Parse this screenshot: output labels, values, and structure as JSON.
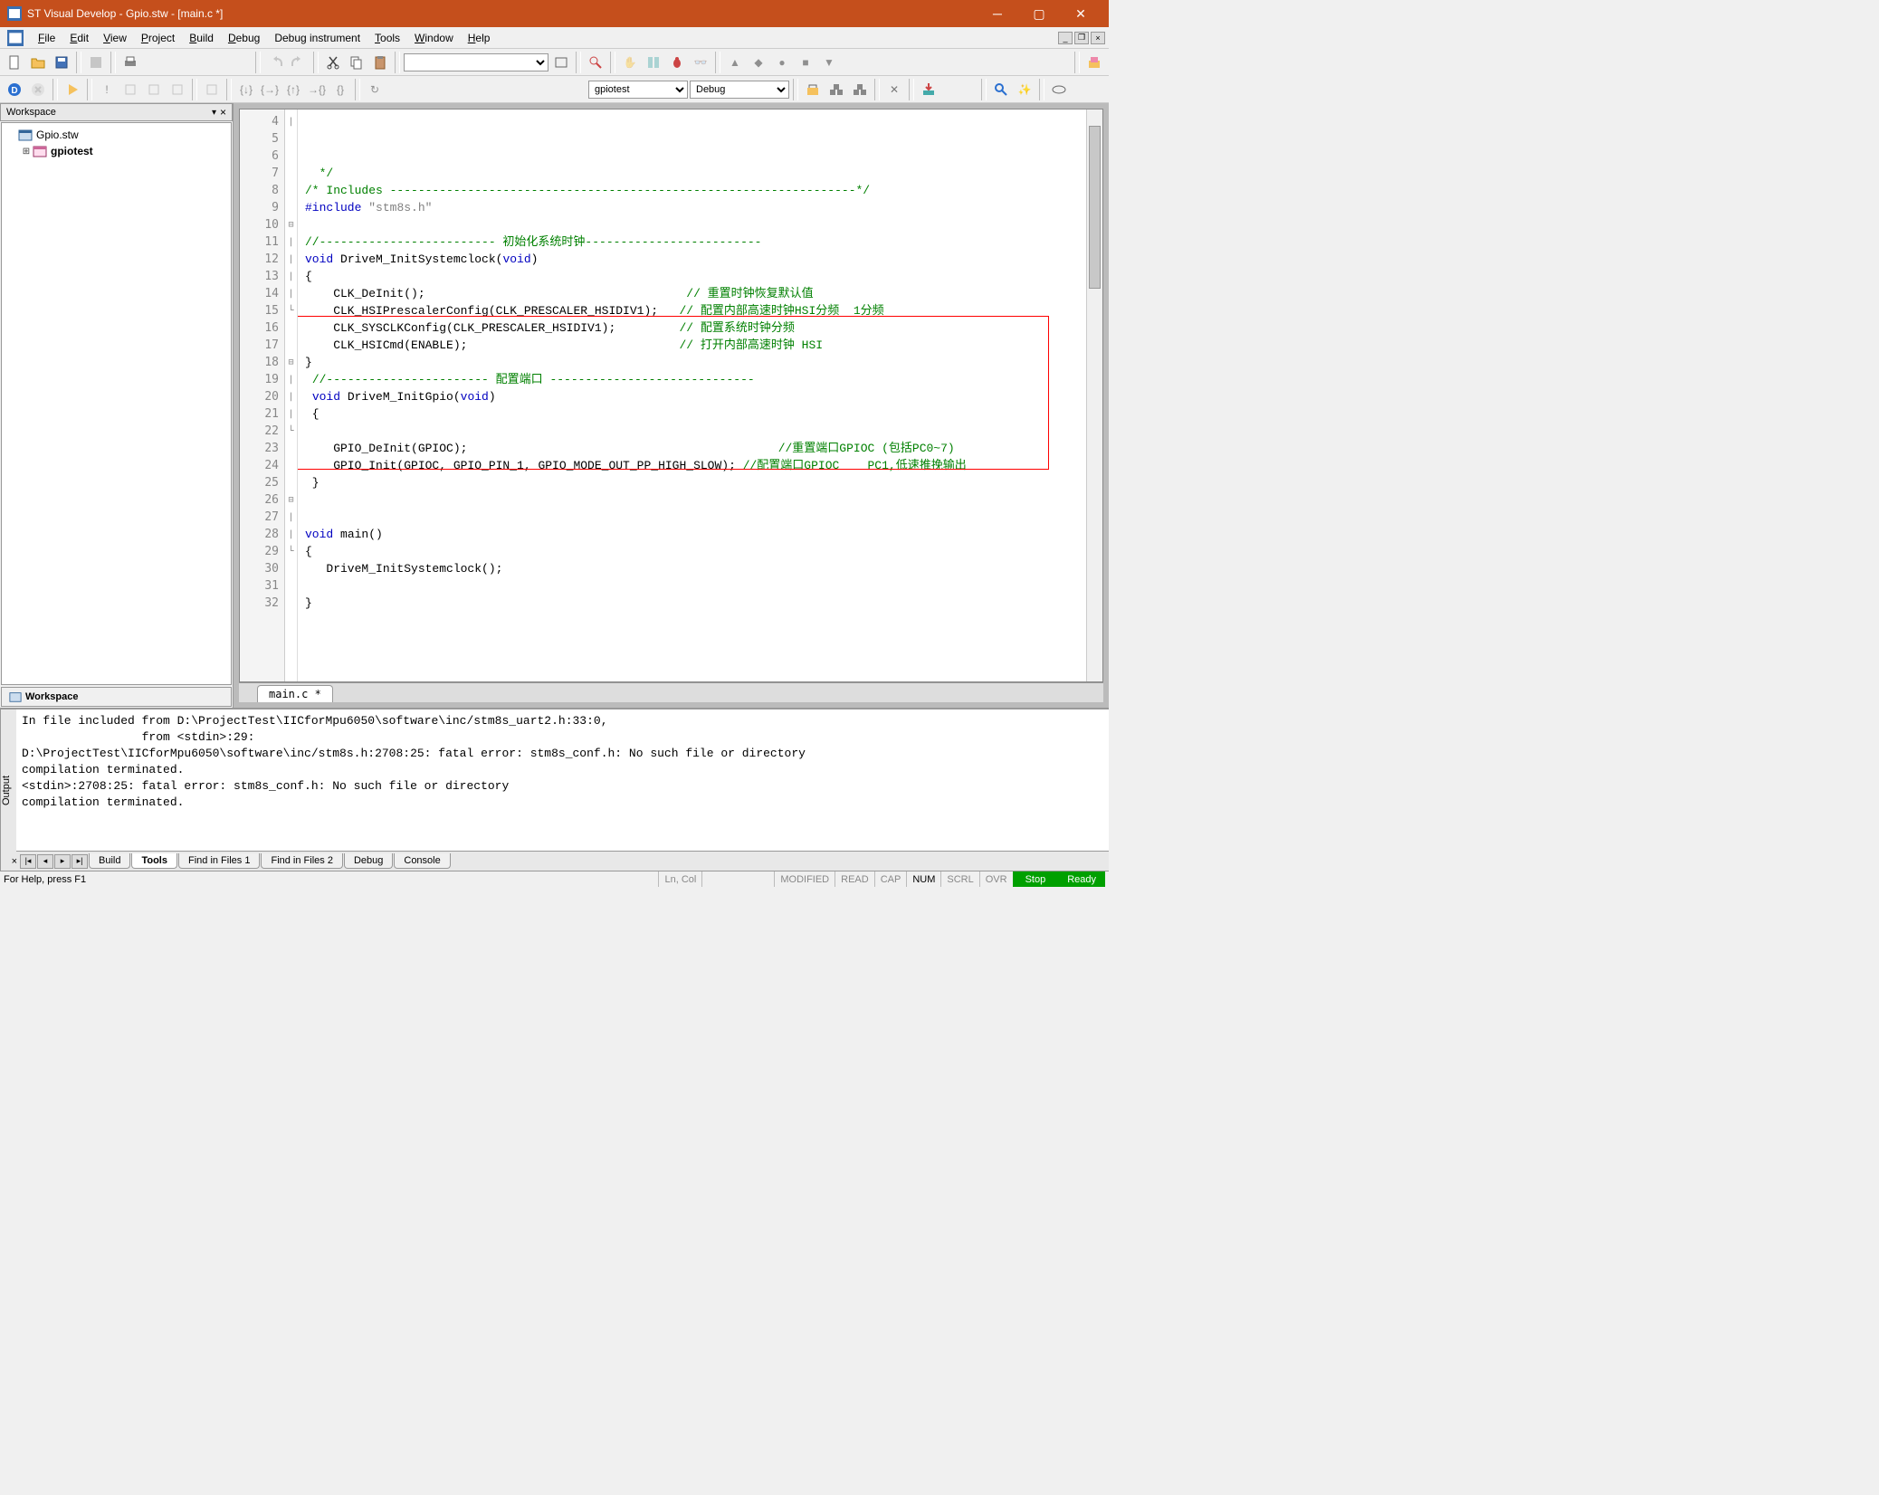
{
  "title": "ST Visual Develop - Gpio.stw - [main.c *]",
  "menu": {
    "file": "File",
    "edit": "Edit",
    "view": "View",
    "project": "Project",
    "build": "Build",
    "debug": "Debug",
    "debug_instrument": "Debug instrument",
    "tools": "Tools",
    "window": "Window",
    "help": "Help"
  },
  "workspace": {
    "header": "Workspace",
    "root": "Gpio.stw",
    "project": "gpiotest",
    "tab": "Workspace"
  },
  "combos": {
    "target": "gpiotest",
    "config": "Debug"
  },
  "editor": {
    "tab": "main.c *",
    "lines": [
      {
        "n": 4,
        "fold": "|",
        "html": "  <span class='c-comment'>*/</span>"
      },
      {
        "n": 5,
        "fold": "",
        "html": "<span class='c-comment'>/* Includes ------------------------------------------------------------------*/</span>"
      },
      {
        "n": 6,
        "fold": "",
        "html": "<span class='c-pp'>#include</span> <span class='c-str'>\"stm8s.h\"</span>"
      },
      {
        "n": 7,
        "fold": "",
        "html": ""
      },
      {
        "n": 8,
        "fold": "",
        "html": "<span class='c-comment'>//------------------------- 初始化系统时钟-------------------------</span>"
      },
      {
        "n": 9,
        "fold": "",
        "html": "<span class='c-kw'>void</span> DriveM_InitSystemclock(<span class='c-kw'>void</span>)"
      },
      {
        "n": 10,
        "fold": "⊟",
        "html": "{"
      },
      {
        "n": 11,
        "fold": "|",
        "html": "    CLK_DeInit();                                     <span class='c-comment'>// 重置时钟恢复默认值</span>"
      },
      {
        "n": 12,
        "fold": "|",
        "html": "    CLK_HSIPrescalerConfig(CLK_PRESCALER_HSIDIV1);   <span class='c-comment'>// 配置内部高速时钟HSI分频  1分频</span>"
      },
      {
        "n": 13,
        "fold": "|",
        "html": "    CLK_SYSCLKConfig(CLK_PRESCALER_HSIDIV1);         <span class='c-comment'>// 配置系统时钟分频</span>"
      },
      {
        "n": 14,
        "fold": "|",
        "html": "    CLK_HSICmd(ENABLE);                              <span class='c-comment'>// 打开内部高速时钟 HSI</span>"
      },
      {
        "n": 15,
        "fold": "└",
        "html": "}"
      },
      {
        "n": 16,
        "fold": "",
        "html": " <span class='c-comment'>//----------------------- 配置端口 -----------------------------</span>"
      },
      {
        "n": 17,
        "fold": "",
        "html": " <span class='c-kw'>void</span> DriveM_InitGpio(<span class='c-kw'>void</span>)"
      },
      {
        "n": 18,
        "fold": "⊟",
        "html": " {"
      },
      {
        "n": 19,
        "fold": "|",
        "html": ""
      },
      {
        "n": 20,
        "fold": "|",
        "html": "    GPIO_DeInit(GPIOC);                                            <span class='c-comment'>//重置端口GPIOC (包括PC0~7)</span>"
      },
      {
        "n": 21,
        "fold": "|",
        "html": "    GPIO_Init(GPIOC, GPIO_PIN_1, GPIO_MODE_OUT_PP_HIGH_SLOW); <span class='c-comment'>//配置端口GPIOC    PC1,低速推挽输出</span>"
      },
      {
        "n": 22,
        "fold": "└",
        "html": " }"
      },
      {
        "n": 23,
        "fold": "",
        "html": ""
      },
      {
        "n": 24,
        "fold": "",
        "html": ""
      },
      {
        "n": 25,
        "fold": "",
        "html": "<span class='c-kw'>void</span> main()"
      },
      {
        "n": 26,
        "fold": "⊟",
        "html": "{"
      },
      {
        "n": 27,
        "fold": "|",
        "html": "   DriveM_InitSystemclock();"
      },
      {
        "n": 28,
        "fold": "|",
        "html": ""
      },
      {
        "n": 29,
        "fold": "└",
        "html": "}"
      },
      {
        "n": 30,
        "fold": "",
        "html": ""
      },
      {
        "n": 31,
        "fold": "",
        "html": ""
      },
      {
        "n": 32,
        "fold": "",
        "html": ""
      }
    ]
  },
  "output": {
    "text": "In file included from D:\\ProjectTest\\IICforMpu6050\\software\\inc/stm8s_uart2.h:33:0,\n                 from <stdin>:29:\nD:\\ProjectTest\\IICforMpu6050\\software\\inc/stm8s.h:2708:25: fatal error: stm8s_conf.h: No such file or directory\ncompilation terminated.\n<stdin>:2708:25: fatal error: stm8s_conf.h: No such file or directory\ncompilation terminated.",
    "tabs": [
      "Build",
      "Tools",
      "Find in Files 1",
      "Find in Files 2",
      "Debug",
      "Console"
    ],
    "active_tab": "Tools",
    "side_label": "Output"
  },
  "status": {
    "help": "For Help, press F1",
    "lncol": "Ln, Col",
    "modified": "MODIFIED",
    "read": "READ",
    "cap": "CAP",
    "num": "NUM",
    "scrl": "SCRL",
    "ovr": "OVR",
    "stop": "Stop",
    "ready": "Ready"
  }
}
